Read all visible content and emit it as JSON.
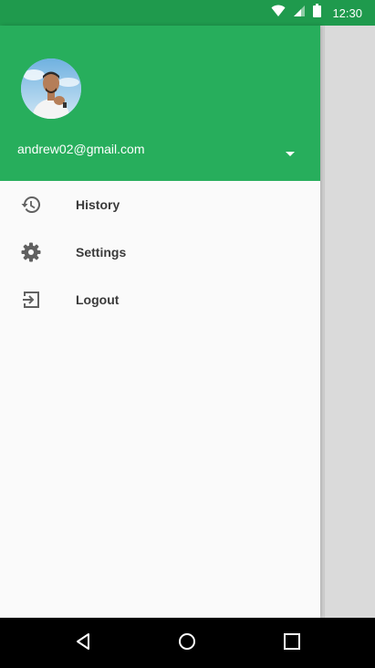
{
  "status_bar": {
    "time": "12:30",
    "icons": [
      "wifi-icon",
      "cellular-signal-icon",
      "battery-icon"
    ]
  },
  "drawer": {
    "header": {
      "background_color": "#27ae5c",
      "email": "andrew02@gmail.com"
    },
    "items": [
      {
        "label": "History",
        "icon": "history-icon"
      },
      {
        "label": "Settings",
        "icon": "gear-icon"
      },
      {
        "label": "Logout",
        "icon": "logout-icon"
      }
    ]
  },
  "nav_bar": {
    "buttons": [
      "back-icon",
      "home-icon",
      "recents-icon"
    ]
  },
  "colors": {
    "status_bar": "#1f9a4d",
    "accent_green": "#27ae5c",
    "drawer_bg": "#fafafa",
    "icon_gray": "#616161"
  }
}
